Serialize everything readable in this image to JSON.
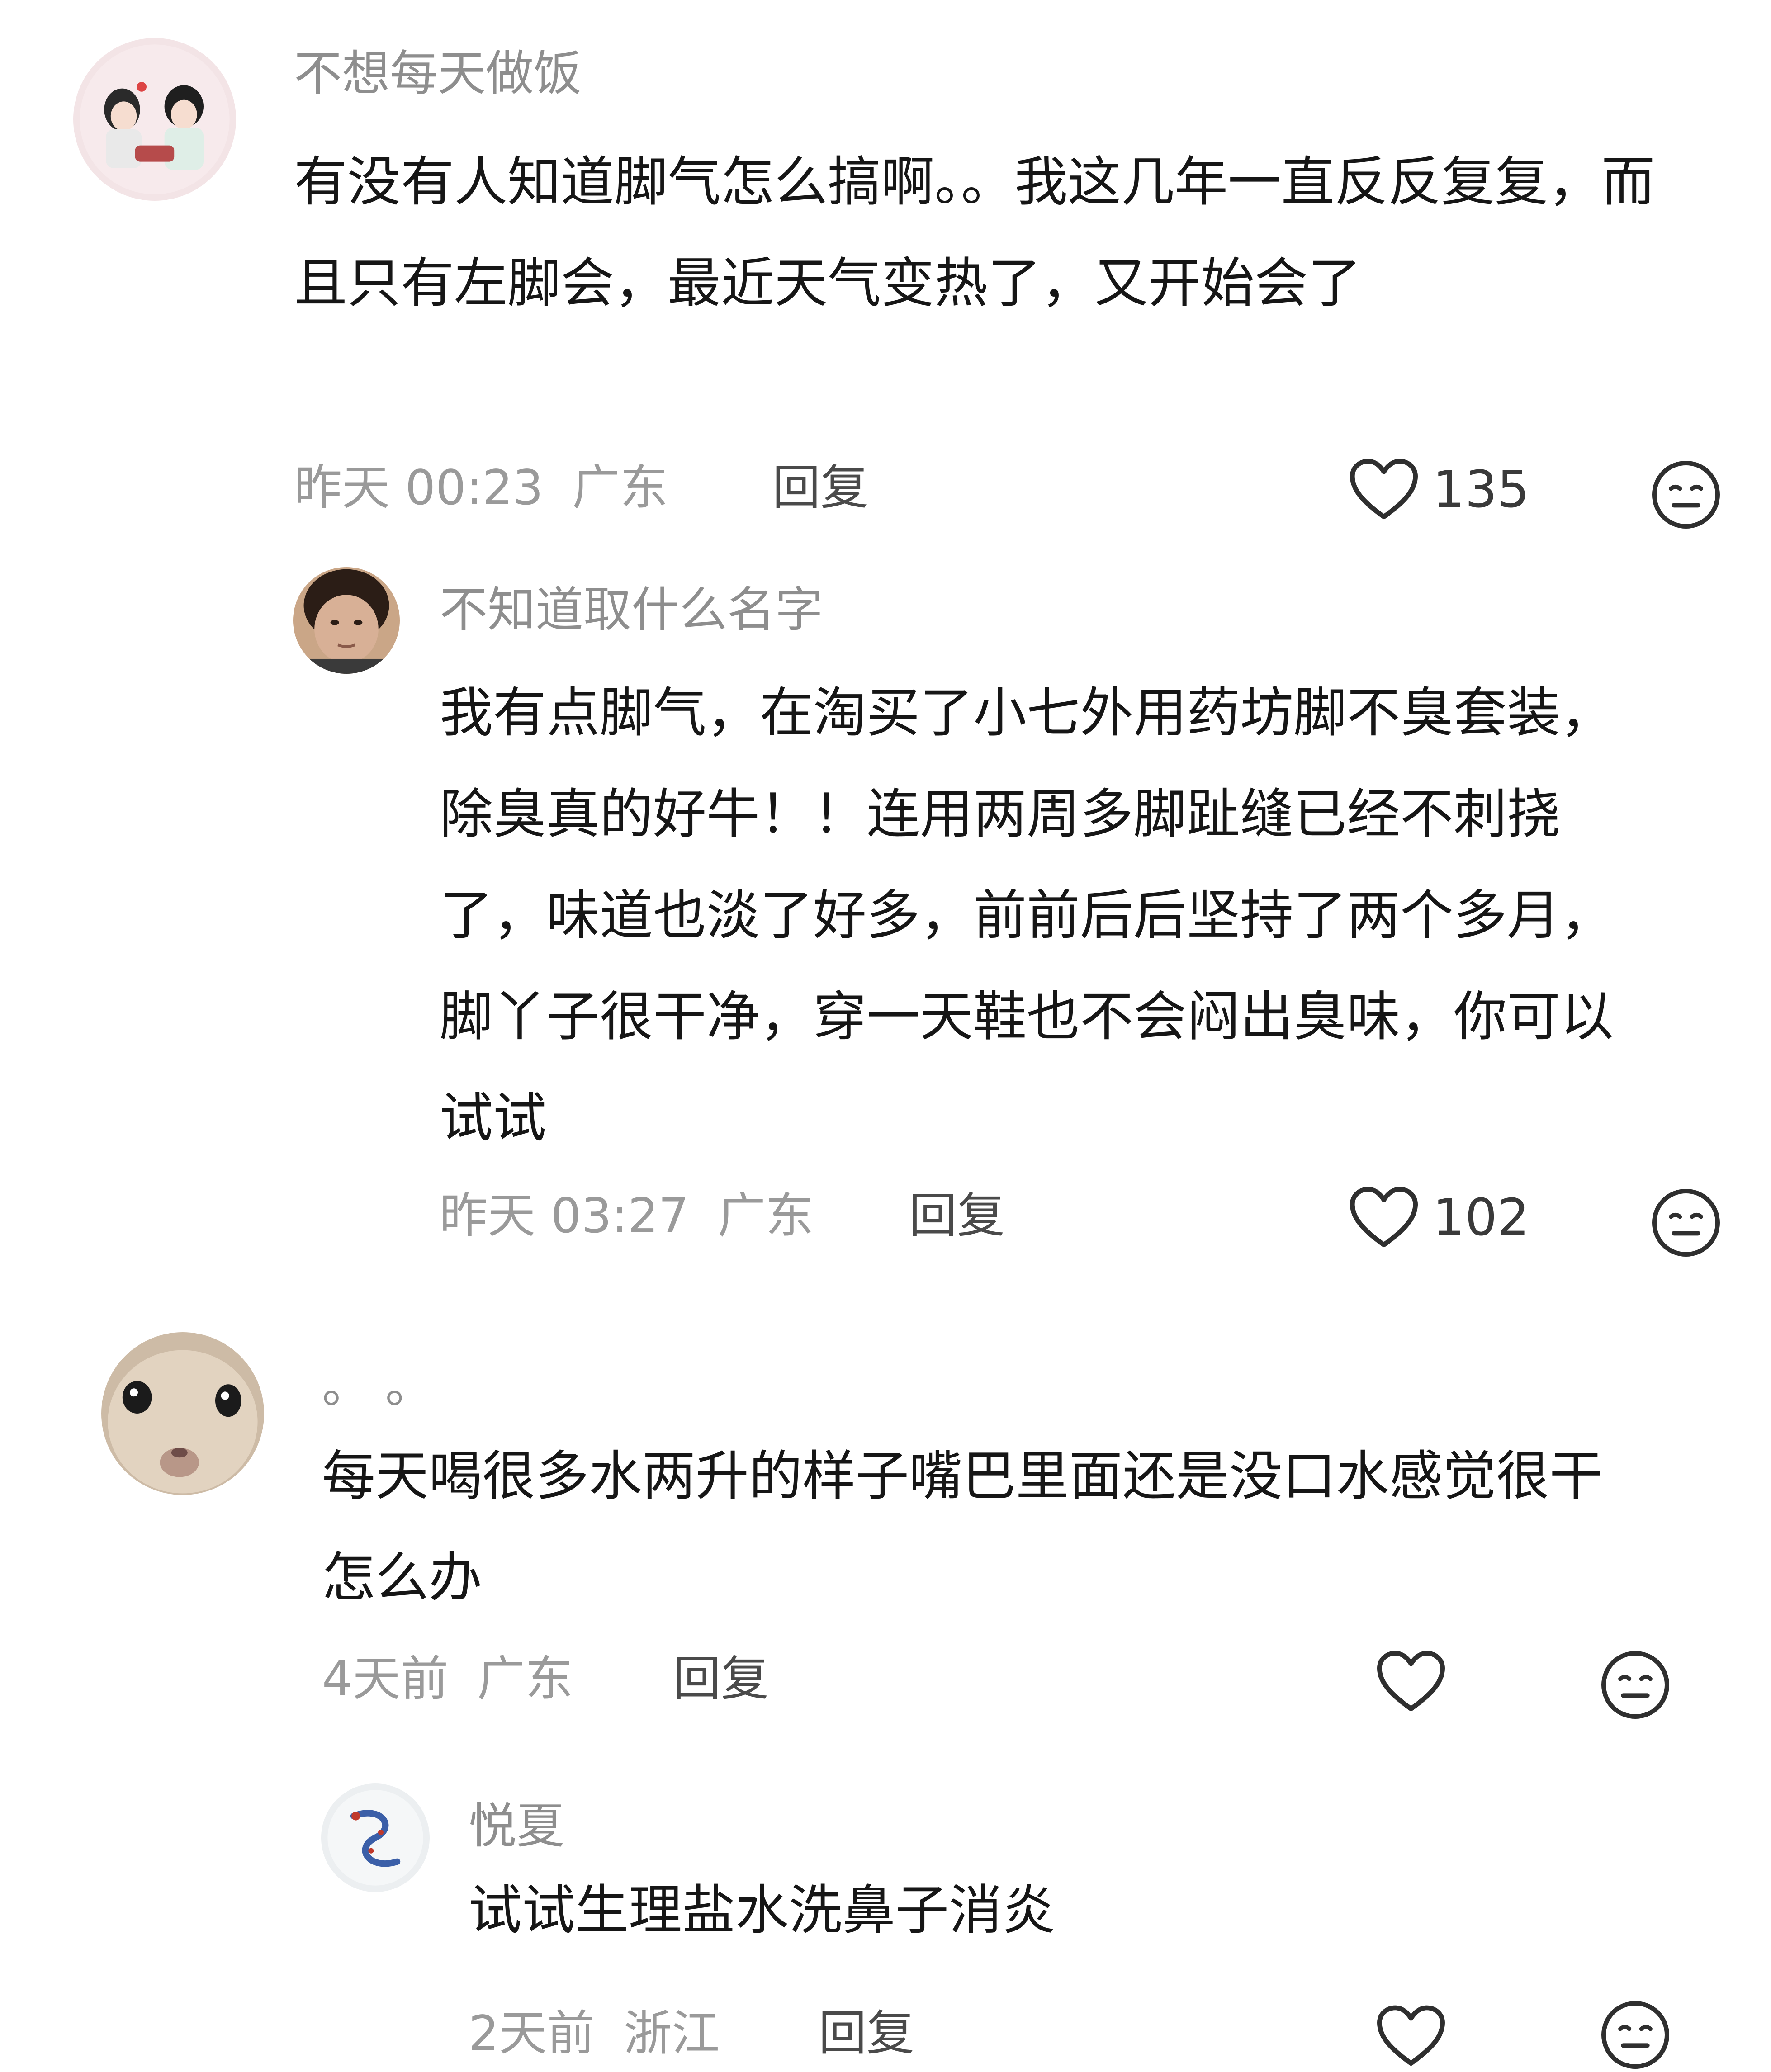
{
  "comments": [
    {
      "username": "不想每天做饭",
      "text": "有没有人知道脚气怎么搞啊。。我这几年一直反反复复，而且只有左脚会，最近天气变热了，又开始会了",
      "time": "昨天 00:23",
      "location": "广东",
      "reply_label": "回复",
      "likes": "135",
      "icons": {
        "like": "heart-outline-icon",
        "reaction": "neutral-face-icon"
      },
      "replies": [
        {
          "username": "不知道取什么名字",
          "text": "我有点脚气，在淘买了小七外用药坊脚不臭套装，除臭真的好牛！！连用两周多脚趾缝已经不刺挠了，味道也淡了好多，前前后后坚持了两个多月，脚丫子很干净，穿一天鞋也不会闷出臭味，你可以试试",
          "time": "昨天 03:27",
          "location": "广东",
          "reply_label": "回复",
          "likes": "102"
        }
      ]
    },
    {
      "username": "。 。",
      "text": "每天喝很多水两升的样子嘴巴里面还是没口水感觉很干怎么办",
      "time": "4天前",
      "location": "广东",
      "reply_label": "回复",
      "likes": "",
      "replies": [
        {
          "username": "悦夏",
          "text": "试试生理盐水洗鼻子消炎",
          "time": "2天前",
          "location": "浙江",
          "reply_label": "回复",
          "likes": ""
        }
      ]
    }
  ]
}
